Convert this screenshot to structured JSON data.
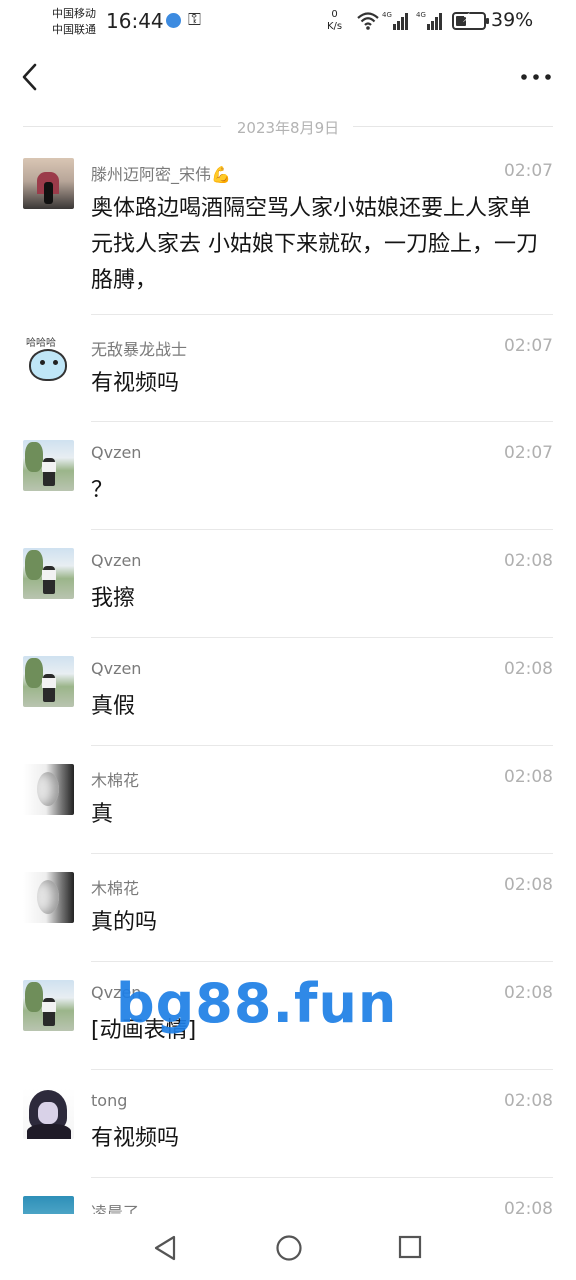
{
  "status_bar": {
    "carrier_1": "中国移动",
    "carrier_2": "中国联通",
    "time": "16:44",
    "net_speed_value": "0",
    "net_speed_unit": "K/s",
    "signal_1_label": "4G",
    "signal_2_label": "4G",
    "battery_percent": "39%",
    "battery_level": 0.39
  },
  "date_divider": "2023年8月9日",
  "messages": [
    {
      "sender": "滕州迈阿密_宋伟💪",
      "time": "02:07",
      "text": "奥体路边喝酒隔空骂人家小姑娘还要上人家单元找人家去 小姑娘下来就砍，一刀脸上，一刀胳膊，",
      "avatar": "photo"
    },
    {
      "sender": "无敌暴龙战士",
      "time": "02:07",
      "text": "有视频吗",
      "avatar": "cartoon"
    },
    {
      "sender": "Qvzen",
      "time": "02:07",
      "text": "？",
      "avatar": "park"
    },
    {
      "sender": "Qvzen",
      "time": "02:08",
      "text": "我擦",
      "avatar": "park"
    },
    {
      "sender": "Qvzen",
      "time": "02:08",
      "text": "真假",
      "avatar": "park"
    },
    {
      "sender": "木棉花",
      "time": "02:08",
      "text": "真",
      "avatar": "face"
    },
    {
      "sender": "木棉花",
      "time": "02:08",
      "text": "真的吗",
      "avatar": "face"
    },
    {
      "sender": "Qvzen",
      "time": "02:08",
      "text": "[动画表情]",
      "avatar": "park"
    },
    {
      "sender": "tong",
      "time": "02:08",
      "text": "有视频吗",
      "avatar": "anime"
    },
    {
      "sender": "凌晨了",
      "time": "02:08",
      "text": "",
      "avatar": "sea"
    }
  ],
  "watermark": "bg88.fun",
  "icons": {
    "back": "chevron-left-icon",
    "more": "more-dots-icon",
    "nav_back": "triangle-back-icon",
    "nav_home": "circle-home-icon",
    "nav_recent": "square-recent-icon"
  }
}
